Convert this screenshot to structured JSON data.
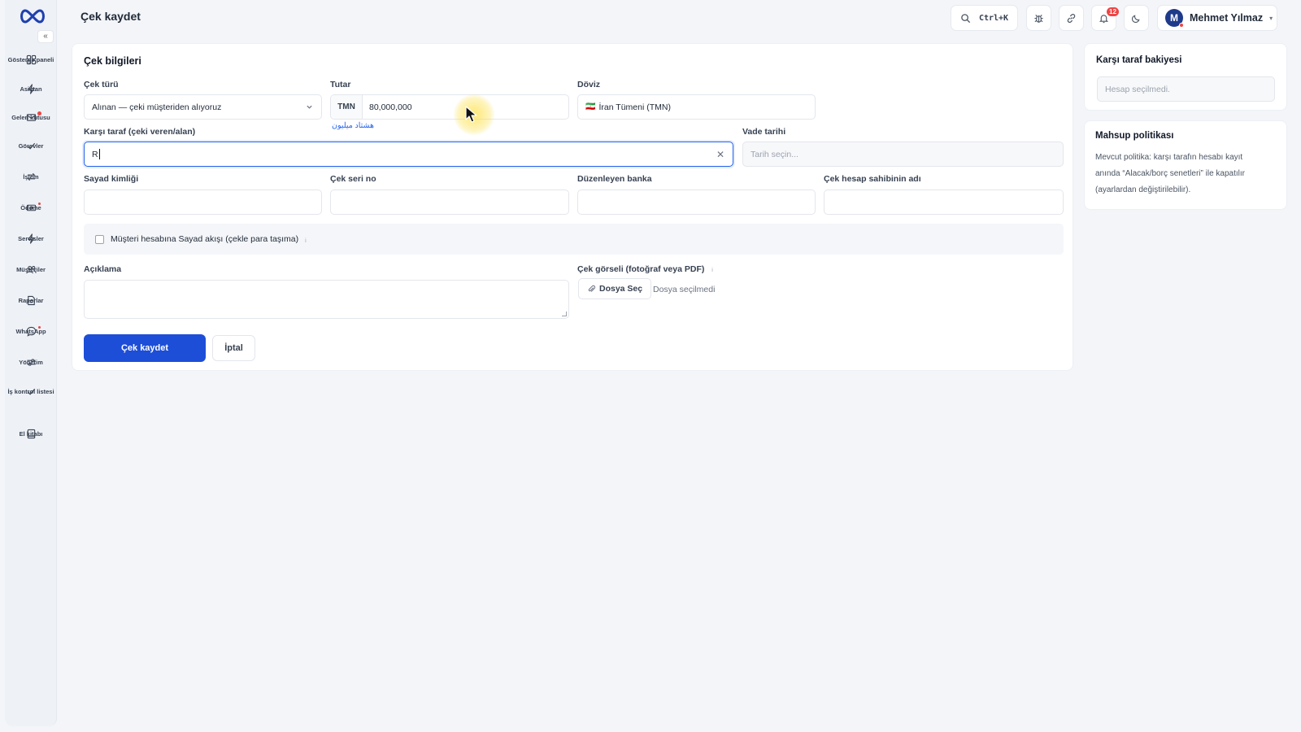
{
  "page": {
    "title": "Çek kaydet"
  },
  "header": {
    "search_shortcut": "Ctrl+K",
    "notifications_count": "12",
    "user": {
      "initial": "M",
      "name": "Mehmet Yılmaz"
    }
  },
  "sidebar": {
    "items": [
      {
        "label": "Gösterge paneli",
        "icon": "dashboard-icon"
      },
      {
        "label": "Asistan",
        "icon": "bolt-icon"
      },
      {
        "label": "Gelen kutusu",
        "icon": "inbox-icon"
      },
      {
        "label": "Görevler",
        "icon": "check-icon"
      },
      {
        "label": "İşlem",
        "icon": "transfer-icon"
      },
      {
        "label": "Ödeme",
        "icon": "payment-icon"
      },
      {
        "label": "Servisler",
        "icon": "bolt-icon"
      },
      {
        "label": "Müşteriler",
        "icon": "users-icon"
      },
      {
        "label": "Raporlar",
        "icon": "report-icon"
      },
      {
        "label": "WhatsApp",
        "icon": "chat-icon"
      },
      {
        "label": "Yönetim",
        "icon": "sliders-icon"
      },
      {
        "label": "İş kontrol listesi",
        "icon": "check-icon"
      },
      {
        "label": "El kitabı",
        "icon": "book-icon"
      }
    ]
  },
  "form": {
    "section_title": "Çek bilgileri",
    "check_type": {
      "label": "Çek türü",
      "value": "Alınan — çeki müşteriden alıyoruz"
    },
    "amount": {
      "label": "Tutar",
      "prefix": "TMN",
      "value": "80,000,000",
      "hint": "هشتاد میلیون"
    },
    "currency": {
      "label": "Döviz",
      "flag": "🇮🇷",
      "value": "İran Tümeni (TMN)"
    },
    "counterparty": {
      "label": "Karşı taraf (çeki veren/alan)",
      "value": "R"
    },
    "due_date": {
      "label": "Vade tarihi",
      "placeholder": "Tarih seçin..."
    },
    "sayad_id": {
      "label": "Sayad kimliği",
      "value": ""
    },
    "serial_no": {
      "label": "Çek seri no",
      "value": ""
    },
    "issuing_bank": {
      "label": "Düzenleyen banka",
      "value": ""
    },
    "account_holder": {
      "label": "Çek hesap sahibinin adı",
      "value": ""
    },
    "sayad_flow": {
      "label": "Müşteri hesabına Sayad akışı (çekle para taşıma)",
      "checked": false,
      "info": "i"
    },
    "description": {
      "label": "Açıklama",
      "value": ""
    },
    "image": {
      "label": "Çek görseli (fotoğraf veya PDF)",
      "info": "i",
      "button": "Dosya Seç",
      "status": "Dosya seçilmedi"
    },
    "submit": "Çek kaydet",
    "cancel": "İptal"
  },
  "balance_panel": {
    "title": "Karşı taraf bakiyesi",
    "placeholder": "Hesap seçilmedi."
  },
  "policy_panel": {
    "title": "Mahsup politikası",
    "lines": [
      "Mevcut politika: karşı tarafın hesabı kayıt",
      "anında “Alacak/borç senetleri” ile kapatılır",
      "(ayarlardan değiştirilebilir)."
    ]
  },
  "colors": {
    "primary": "#1d4ed8",
    "danger": "#ef4444",
    "background": "#f3f5f9"
  }
}
